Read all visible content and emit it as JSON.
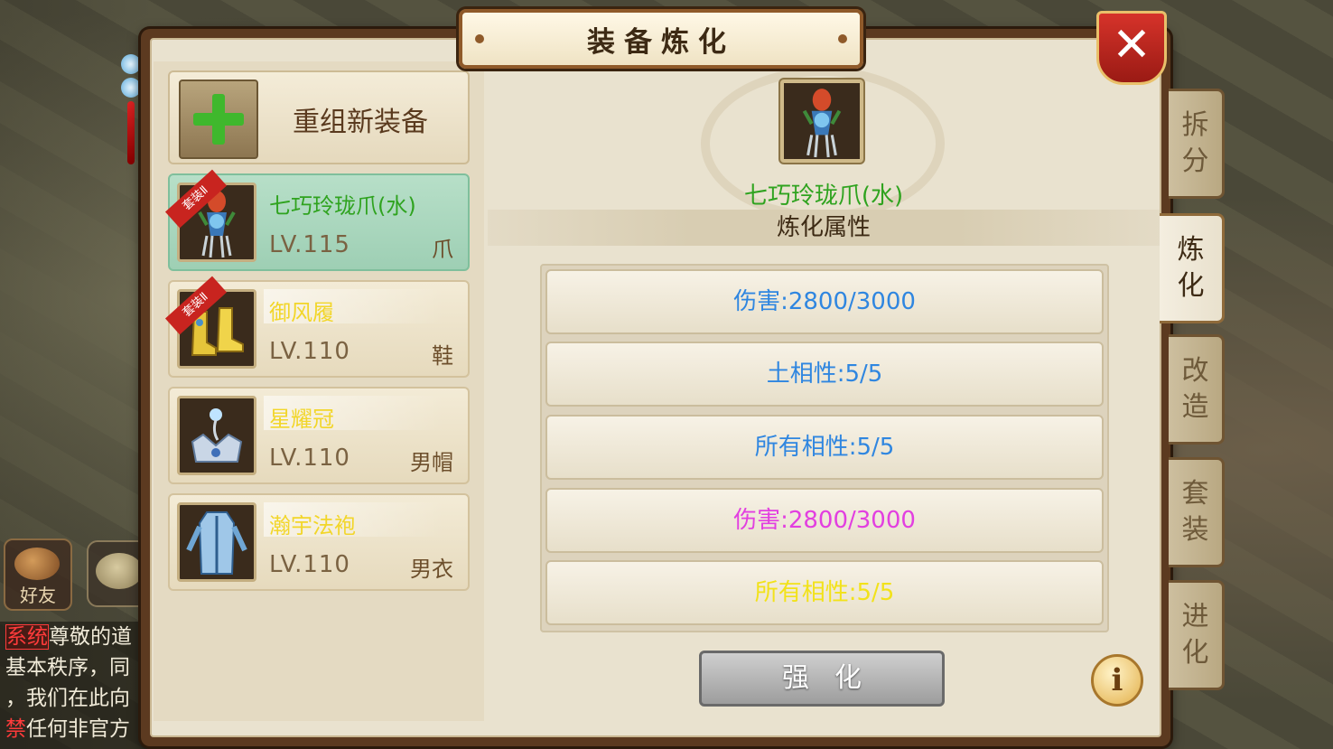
{
  "window": {
    "title": "装备炼化"
  },
  "close_label": "✕",
  "new_equip": {
    "label": "重组新装备"
  },
  "equipment_list": [
    {
      "name": "七巧玲珑爪(水)",
      "level": "LV.115",
      "kind": "爪",
      "name_color": "#2fa31f",
      "ribbon": "套装Ⅱ",
      "selected": true,
      "icon": "claw-icon"
    },
    {
      "name": "御风履",
      "level": "LV.110",
      "kind": "鞋",
      "name_color": "#f2d62a",
      "ribbon": "套装Ⅱ",
      "selected": false,
      "icon": "boots-icon"
    },
    {
      "name": "星耀冠",
      "level": "LV.110",
      "kind": "男帽",
      "name_color": "#f2d62a",
      "ribbon": "",
      "selected": false,
      "icon": "crown-icon"
    },
    {
      "name": "瀚宇法袍",
      "level": "LV.110",
      "kind": "男衣",
      "name_color": "#f2d62a",
      "ribbon": "",
      "selected": false,
      "icon": "robe-icon"
    }
  ],
  "preview": {
    "name": "七巧玲珑爪(水)",
    "icon": "claw-icon"
  },
  "attr_header": "炼化属性",
  "attributes": [
    {
      "text": "伤害:2800/3000",
      "color": "#2f86e0"
    },
    {
      "text": "土相性:5/5",
      "color": "#2f86e0"
    },
    {
      "text": "所有相性:5/5",
      "color": "#2f86e0"
    },
    {
      "text": "伤害:2800/3000",
      "color": "#e23fe0"
    },
    {
      "text": "所有相性:5/5",
      "color": "#f2e21a"
    }
  ],
  "strengthen_label": "强化",
  "info_label": "i",
  "side_tabs": [
    {
      "label": "拆分",
      "active": false
    },
    {
      "label": "炼化",
      "active": true
    },
    {
      "label": "改造",
      "active": false
    },
    {
      "label": "套装",
      "active": false
    },
    {
      "label": "进化",
      "active": false
    }
  ],
  "background": {
    "friend_label": "好友",
    "chat_lines": [
      {
        "tag": "系统",
        "text": "尊敬的道"
      },
      {
        "text": "基本秩序，同"
      },
      {
        "text": "，我们在此向"
      },
      {
        "prefix": "禁",
        "text": "任何非官方"
      }
    ]
  }
}
